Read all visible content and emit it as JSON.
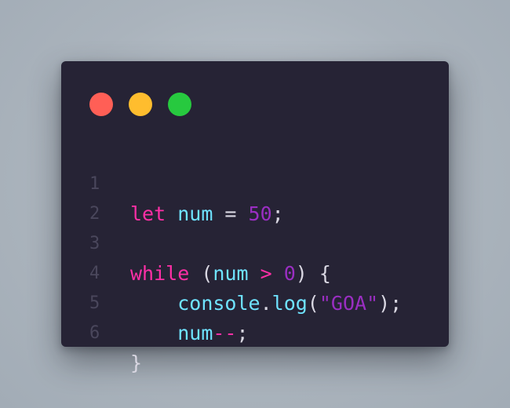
{
  "window": {
    "controls": {
      "close_color": "#ff5f56",
      "minimize_color": "#ffbd2e",
      "maximize_color": "#27c93f"
    }
  },
  "code": {
    "language": "javascript",
    "lines": [
      {
        "number": "1",
        "text": "let num = 50;"
      },
      {
        "number": "2",
        "text": ""
      },
      {
        "number": "3",
        "text": "while (num > 0) {"
      },
      {
        "number": "4",
        "text": "    console.log(\"GOA\");"
      },
      {
        "number": "5",
        "text": "    num--;"
      },
      {
        "number": "6",
        "text": "}"
      }
    ],
    "tokens": {
      "l1": {
        "kw": "let",
        "var": "num",
        "eq": " = ",
        "num": "50",
        "semi": ";"
      },
      "l3": {
        "kw": "while",
        "sp": " ",
        "open": "(",
        "var": "num",
        "op": " > ",
        "num": "0",
        "close": ")",
        "brace": " {"
      },
      "l4": {
        "indent": "    ",
        "obj": "console",
        "dot": ".",
        "fn": "log",
        "open": "(",
        "str": "\"GOA\"",
        "close": ");"
      },
      "l5": {
        "indent": "    ",
        "var": "num",
        "op": "--",
        "semi": ";"
      },
      "l6": {
        "brace": "}"
      }
    }
  }
}
